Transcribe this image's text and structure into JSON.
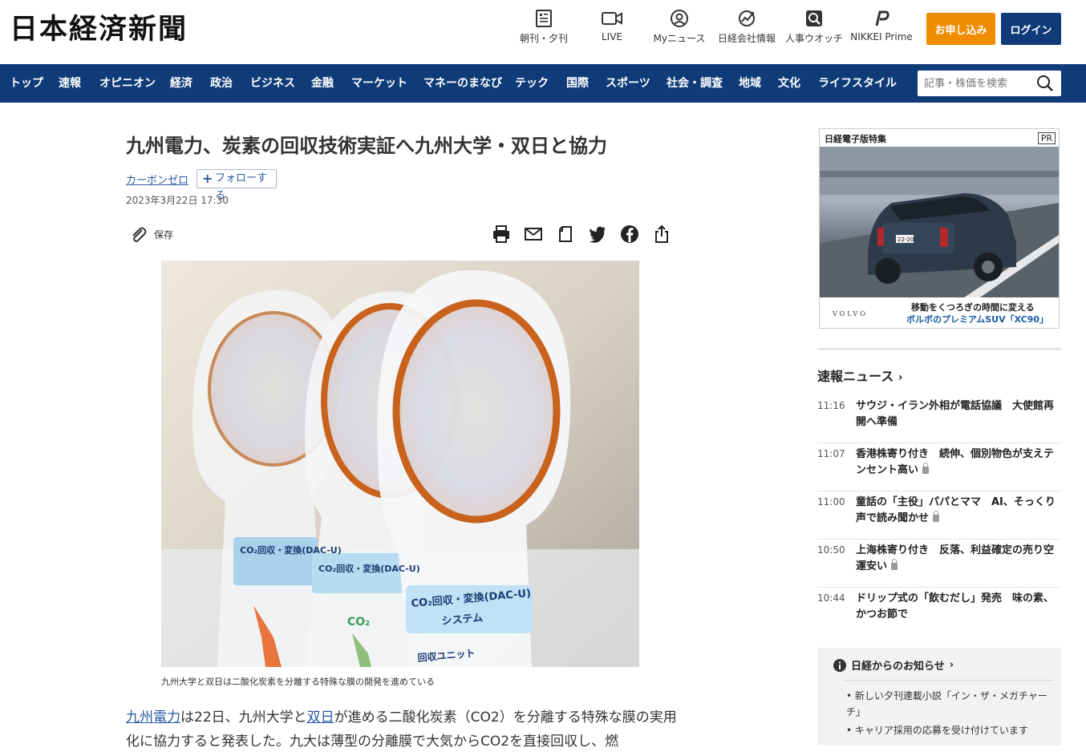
{
  "header": {
    "logo": "日本経済新聞",
    "icons": [
      {
        "label": "朝刊・夕刊",
        "icon": "newspaper-icon"
      },
      {
        "label": "LIVE",
        "icon": "video-icon"
      },
      {
        "label": "Myニュース",
        "icon": "user-icon"
      },
      {
        "label": "日経会社情報",
        "icon": "chart-icon"
      },
      {
        "label": "人事ウオッチ",
        "icon": "person-search-icon"
      },
      {
        "label": "NIKKEI Prime",
        "icon": "prime-icon"
      }
    ],
    "subscribe_label": "お申し込み",
    "login_label": "ログイン",
    "accent": "#f08c00",
    "brand": "#0f3c78"
  },
  "nav": {
    "items": [
      "トップ",
      "速報",
      "オピニオン",
      "経済",
      "政治",
      "ビジネス",
      "金融",
      "マーケット",
      "マネーのまなび",
      "テック",
      "国際",
      "スポーツ",
      "社会・調査",
      "地域",
      "文化",
      "ライフスタイル"
    ],
    "search_placeholder": "記事・株価を検索"
  },
  "article": {
    "title": "九州電力、炭素の回収技術実証へ九州大学・双日と協力",
    "topic": "カーボンゼロ",
    "follow_label": "フォローする",
    "date": "2023年3月22日 17:30",
    "save_label": "保存",
    "share_icons": [
      "print-icon",
      "mail-icon",
      "bookmark-icon",
      "twitter-icon",
      "facebook-icon",
      "share-icon"
    ],
    "photo_texts": [
      "CO₂回収・変換(DAC-U)",
      "システム",
      "回収ユニット",
      "CO₂"
    ],
    "caption": "九州大学と双日は二酸化炭素を分離する特殊な膜の開発を進めている",
    "body_link1": "九州電力",
    "body_part1": "は22日、九州大学と",
    "body_link2": "双日",
    "body_part2": "が進める二酸化炭素（CO2）を分離する特殊な膜の実用化に協力すると発表した。九大は薄型の分離膜で大気からCO2を直接回収し、燃"
  },
  "sidebar": {
    "ad": {
      "label": "日経電子版特集",
      "pr": "PR",
      "brand": "VOLVO",
      "plate": "22-20",
      "line1": "移動をくつろぎの時間に変える",
      "line2": "ボルボのプレミアムSUV「XC90」"
    },
    "news_title": "速報ニュース",
    "news": [
      {
        "time": "11:16",
        "text": "サウジ・イラン外相が電話協議　大使館再開へ準備",
        "locked": false
      },
      {
        "time": "11:07",
        "text": "香港株寄り付き　続伸、個別物色が支えテンセント高い",
        "locked": true
      },
      {
        "time": "11:00",
        "text": "童話の「主役」パパとママ　AI、そっくり声で読み聞かせ",
        "locked": true
      },
      {
        "time": "10:50",
        "text": "上海株寄り付き　反落、利益確定の売り空運安い",
        "locked": true
      },
      {
        "time": "10:44",
        "text": "ドリップ式の「飲むだし」発売　味の素、かつお節で",
        "locked": false
      }
    ],
    "notice_title": "日経からのお知らせ",
    "notices": [
      "新しい夕刊連載小説「イン・ザ・メガチャーチ」",
      "キャリア採用の応募を受け付けています"
    ]
  }
}
